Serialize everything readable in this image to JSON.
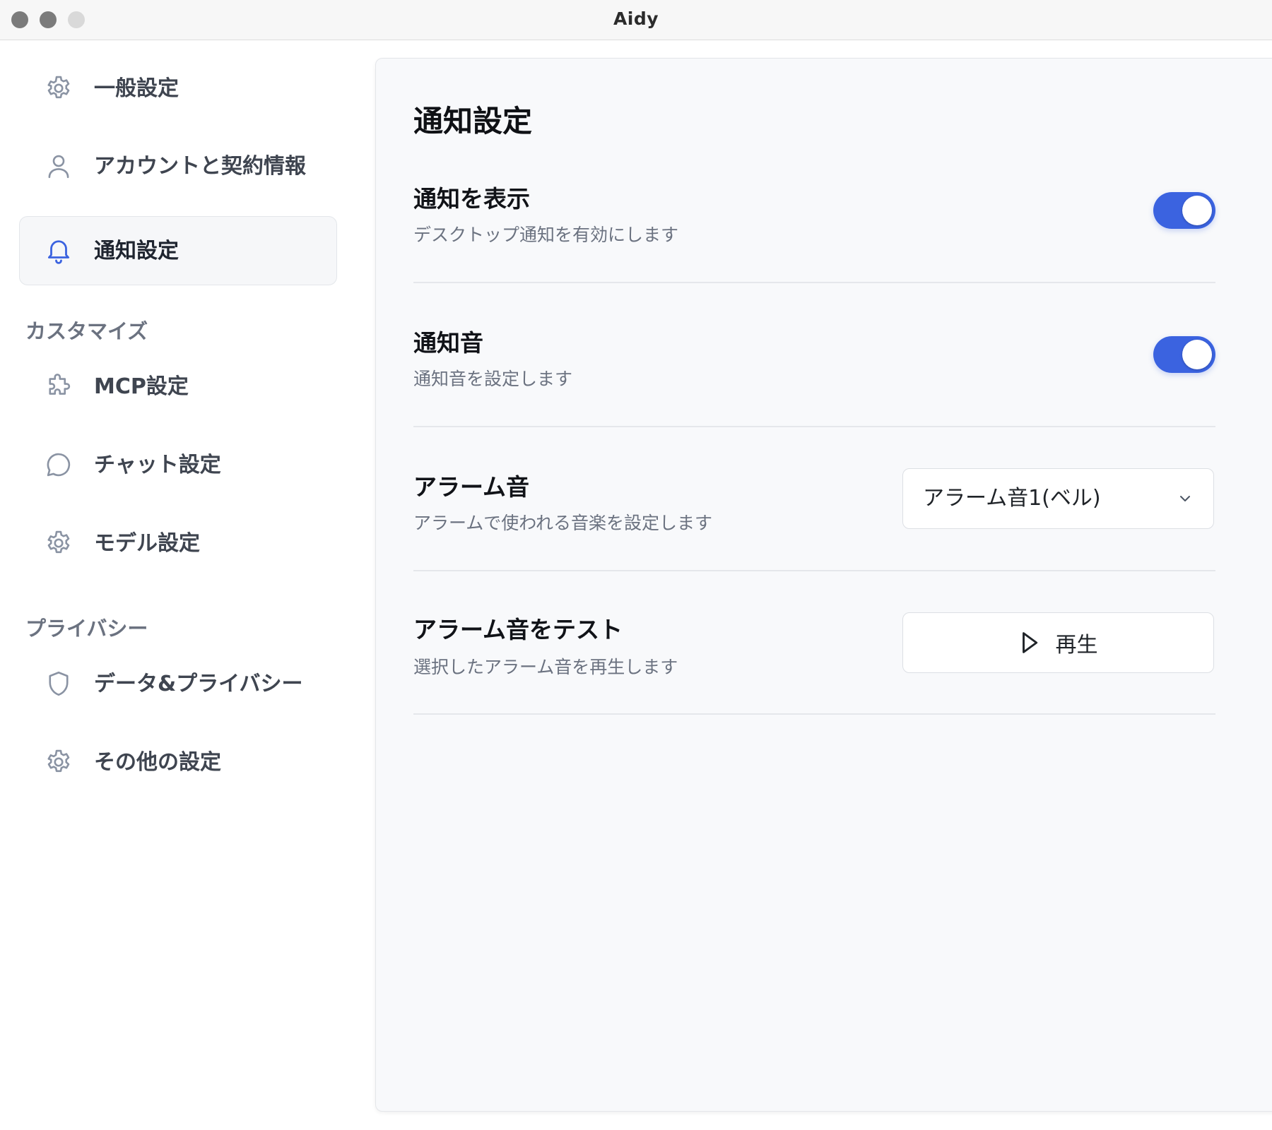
{
  "window": {
    "title": "Aidy"
  },
  "sidebar": {
    "items": [
      {
        "label": "一般設定",
        "icon": "gear-icon"
      },
      {
        "label": "アカウントと契約情報",
        "icon": "user-icon"
      },
      {
        "label": "通知設定",
        "icon": "bell-icon",
        "active": true
      }
    ],
    "sections": [
      {
        "label": "カスタマイズ",
        "items": [
          {
            "label": "MCP設定",
            "icon": "puzzle-icon"
          },
          {
            "label": "チャット設定",
            "icon": "chat-bubble-icon"
          },
          {
            "label": "モデル設定",
            "icon": "gear-icon"
          }
        ]
      },
      {
        "label": "プライバシー",
        "items": [
          {
            "label": "データ&プライバシー",
            "icon": "shield-icon"
          },
          {
            "label": "その他の設定",
            "icon": "gear-icon"
          }
        ]
      }
    ]
  },
  "main": {
    "title": "通知設定",
    "rows": [
      {
        "title": "通知を表示",
        "description": "デスクトップ通知を有効にします",
        "control": "toggle",
        "enabled": true
      },
      {
        "title": "通知音",
        "description": "通知音を設定します",
        "control": "toggle",
        "enabled": true
      },
      {
        "title": "アラーム音",
        "description": "アラームで使われる音楽を設定します",
        "control": "select",
        "selected": "アラーム音1(ベル)"
      },
      {
        "title": "アラーム音をテスト",
        "description": "選択したアラーム音を再生します",
        "control": "button",
        "button_label": "再生",
        "button_icon": "play-icon"
      }
    ]
  },
  "colors": {
    "accent": "#3b63e0",
    "active_icon": "#3b63e0",
    "icon_gray": "#8a93a3"
  }
}
